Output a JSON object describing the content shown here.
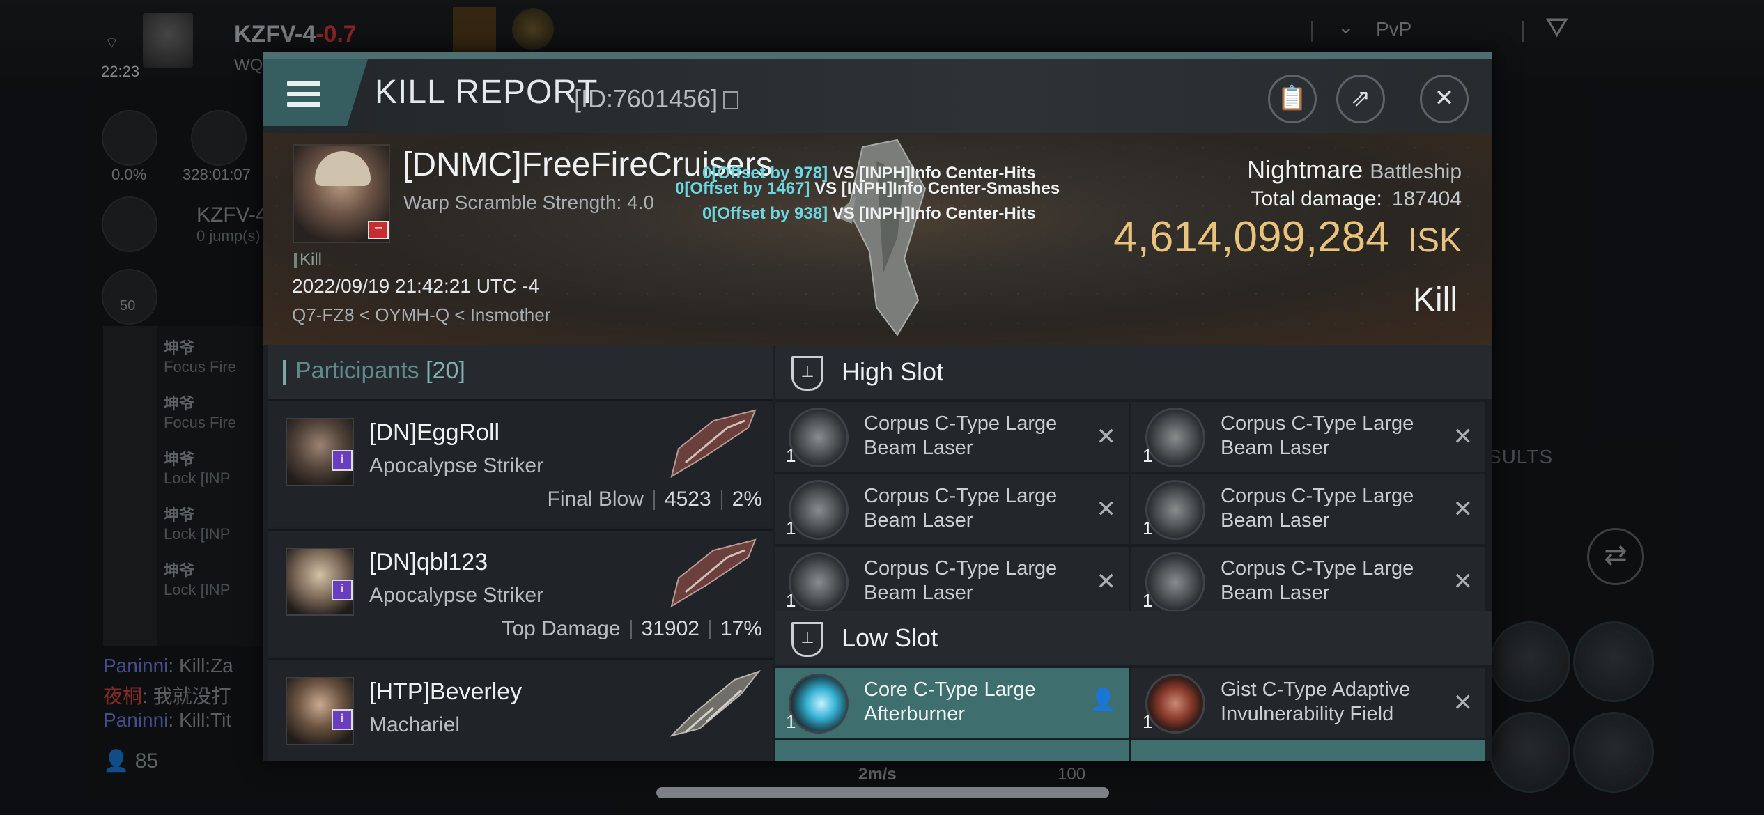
{
  "hud": {
    "time": "22:23",
    "system_name": "KZFV-4",
    "system_security": "-0.7",
    "system_sub": "WQ",
    "pvp_label": "PvP",
    "stat_left": "0.0%",
    "stat_right": "328:01:07",
    "route_system": "KZFV-4",
    "route_jumps": "0 jump(s)",
    "nav_count": "50",
    "results_label": "SULTS",
    "speed": "2m/s",
    "hundred": "100",
    "online_count": "85",
    "feed": [
      {
        "name": "坤爷",
        "action": "Focus Fire"
      },
      {
        "name": "坤爷",
        "action": "Focus Fire"
      },
      {
        "name": "坤爷",
        "action": "Lock [INP"
      },
      {
        "name": "坤爷",
        "action": "Lock [INP"
      },
      {
        "name": "坤爷",
        "action": "Lock [INP"
      }
    ],
    "chat": [
      {
        "name": "Paninni",
        "text": ": Kill:Za"
      },
      {
        "name": "夜桐",
        "text": ": 我就没打"
      },
      {
        "name": "Paninni",
        "text": ": Kill:Tit"
      }
    ]
  },
  "header": {
    "title": "KILL REPORT",
    "id_text": "[ID:7601456]"
  },
  "victim": {
    "name": "[DNMC]FreeFireCruisers",
    "warp_scramble": "Warp Scramble Strength: 4.0",
    "kill_tag": "Kill",
    "datetime": "2022/09/19 21:42:21 UTC -4",
    "route": "Q7-FZ8 < OYMH-Q < Insmother",
    "ship_name": "Nightmare",
    "ship_class": "Battleship",
    "total_damage_label": "Total damage:",
    "total_damage": "187404",
    "isk_value": "4,614,099,284",
    "isk_unit": "ISK",
    "result": "Kill"
  },
  "hits": [
    {
      "offset": "0[Offset by 978]",
      "text": " VS [INPH]Info Center-Hits"
    },
    {
      "offset": "0[Offset by 1467]",
      "text": " VS [INPH]Info Center-Smashes"
    },
    {
      "offset": "0[Offset by 938]",
      "text": " VS [INPH]Info Center-Hits"
    }
  ],
  "participants": {
    "title": "Participants",
    "count": "[20]",
    "rows": [
      {
        "name": "[DN]EggRoll",
        "ship": "Apocalypse Striker",
        "label": "Final Blow",
        "damage": "4523",
        "percent": "2%"
      },
      {
        "name": "[DN]qbl123",
        "ship": "Apocalypse Striker",
        "label": "Top Damage",
        "damage": "31902",
        "percent": "17%"
      },
      {
        "name": "[HTP]Beverley",
        "ship": "Machariel"
      }
    ]
  },
  "slots": {
    "high": {
      "title": "High Slot",
      "modules": [
        {
          "qty": "1",
          "name": "Corpus C-Type Large Beam Laser"
        },
        {
          "qty": "1",
          "name": "Corpus C-Type Large Beam Laser"
        },
        {
          "qty": "1",
          "name": "Corpus C-Type Large Beam Laser"
        },
        {
          "qty": "1",
          "name": "Corpus C-Type Large Beam Laser"
        },
        {
          "qty": "1",
          "name": "Corpus C-Type Large Beam Laser"
        },
        {
          "qty": "1",
          "name": "Corpus C-Type Large Beam Laser"
        }
      ]
    },
    "low": {
      "title": "Low Slot",
      "modules": [
        {
          "qty": "1",
          "name": "Core C-Type Large Afterburner"
        },
        {
          "qty": "1",
          "name": "Gist C-Type Adaptive Invulnerability Field"
        }
      ]
    }
  }
}
